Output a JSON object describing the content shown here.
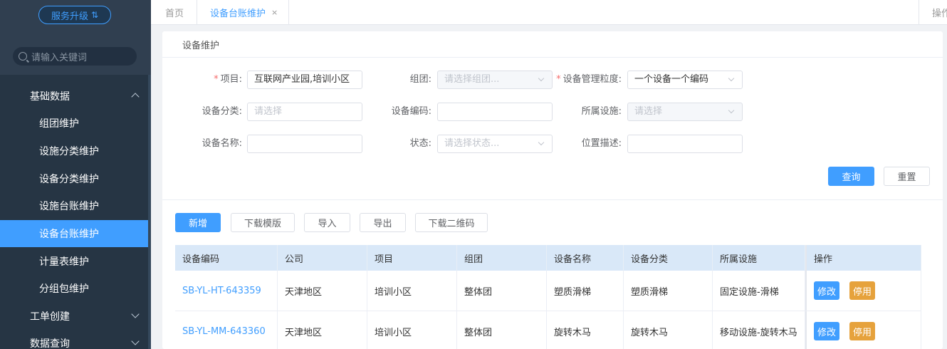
{
  "sidebar": {
    "upgrade_label": "服务升级",
    "upgrade_icon": "⇅",
    "search_placeholder": "请输入关键词",
    "groups": [
      {
        "label": "基础数据"
      },
      {
        "label": "工单创建"
      },
      {
        "label": "数据查询"
      }
    ],
    "items": [
      {
        "label": "组团维护"
      },
      {
        "label": "设施分类维护"
      },
      {
        "label": "设备分类维护"
      },
      {
        "label": "设施台账维护"
      },
      {
        "label": "设备台账维护"
      },
      {
        "label": "计量表维护"
      },
      {
        "label": "分组包维护"
      }
    ]
  },
  "tabs": {
    "home": "首页",
    "active": "设备台账维护",
    "close": "×",
    "ops": "操作"
  },
  "card": {
    "title": "设备维护"
  },
  "form": {
    "project_label": "项目:",
    "project_value": "互联网产业园,培训小区",
    "group_label": "组团:",
    "group_placeholder": "请选择组团...",
    "granularity_label": "设备管理粒度:",
    "granularity_value": "一个设备一个编码",
    "category_label": "设备分类:",
    "category_placeholder": "请选择",
    "code_label": "设备编码:",
    "code_value": "",
    "facility_label": "所属设施:",
    "facility_placeholder": "请选择",
    "name_label": "设备名称:",
    "name_value": "",
    "status_label": "状态:",
    "status_placeholder": "请选择状态...",
    "location_label": "位置描述:",
    "location_value": "",
    "required_mark": "*",
    "query_label": "查询",
    "reset_label": "重置"
  },
  "toolbar": {
    "add": "新增",
    "download_template": "下载模版",
    "import": "导入",
    "export": "导出",
    "download_qr": "下载二维码"
  },
  "table": {
    "headers": [
      "设备编码",
      "公司",
      "项目",
      "组团",
      "设备名称",
      "设备分类",
      "所属设施",
      "操作"
    ],
    "rows": [
      {
        "code": "SB-YL-HT-643359",
        "company": "天津地区",
        "project": "培训小区",
        "group": "整体团",
        "name": "塑质滑梯",
        "category": "塑质滑梯",
        "facility": "固定设施-滑梯",
        "edit": "修改",
        "disable": "停用"
      },
      {
        "code": "SB-YL-MM-643360",
        "company": "天津地区",
        "project": "培训小区",
        "group": "整体团",
        "name": "旋转木马",
        "category": "旋转木马",
        "facility": "移动设施-旋转木马",
        "edit": "修改",
        "disable": "停用"
      }
    ]
  },
  "colors": {
    "primary": "#409eff",
    "warning": "#e6a23c",
    "sidebar_bg": "#263544"
  }
}
